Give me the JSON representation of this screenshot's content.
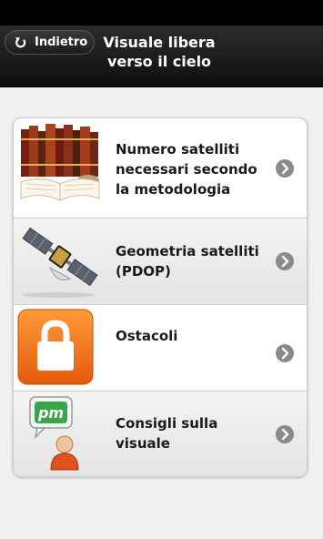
{
  "header": {
    "back_label": "Indietro",
    "title_line1": "Visuale libera",
    "title_line2": "verso il cielo"
  },
  "menu": {
    "items": [
      {
        "label_line1": "Numero satelliti",
        "label_line2": "necessari secondo",
        "label_line3": "la metodologia",
        "icon": "books-icon"
      },
      {
        "label_line1": "Geometria satelliti",
        "label_line2": "(PDOP)",
        "icon": "satellite-icon"
      },
      {
        "label_line1": "Ostacoli",
        "icon": "lock-icon"
      },
      {
        "label_line1": "Consigli sulla",
        "label_line2": "visuale",
        "icon": "pm-advisor-icon",
        "badge_text": "pm"
      }
    ]
  },
  "colors": {
    "header_bg": "#1a1a1a",
    "lock_orange": "#f26b14",
    "pm_green": "#3aa54a",
    "chevron_grey": "#8a8a8a"
  }
}
